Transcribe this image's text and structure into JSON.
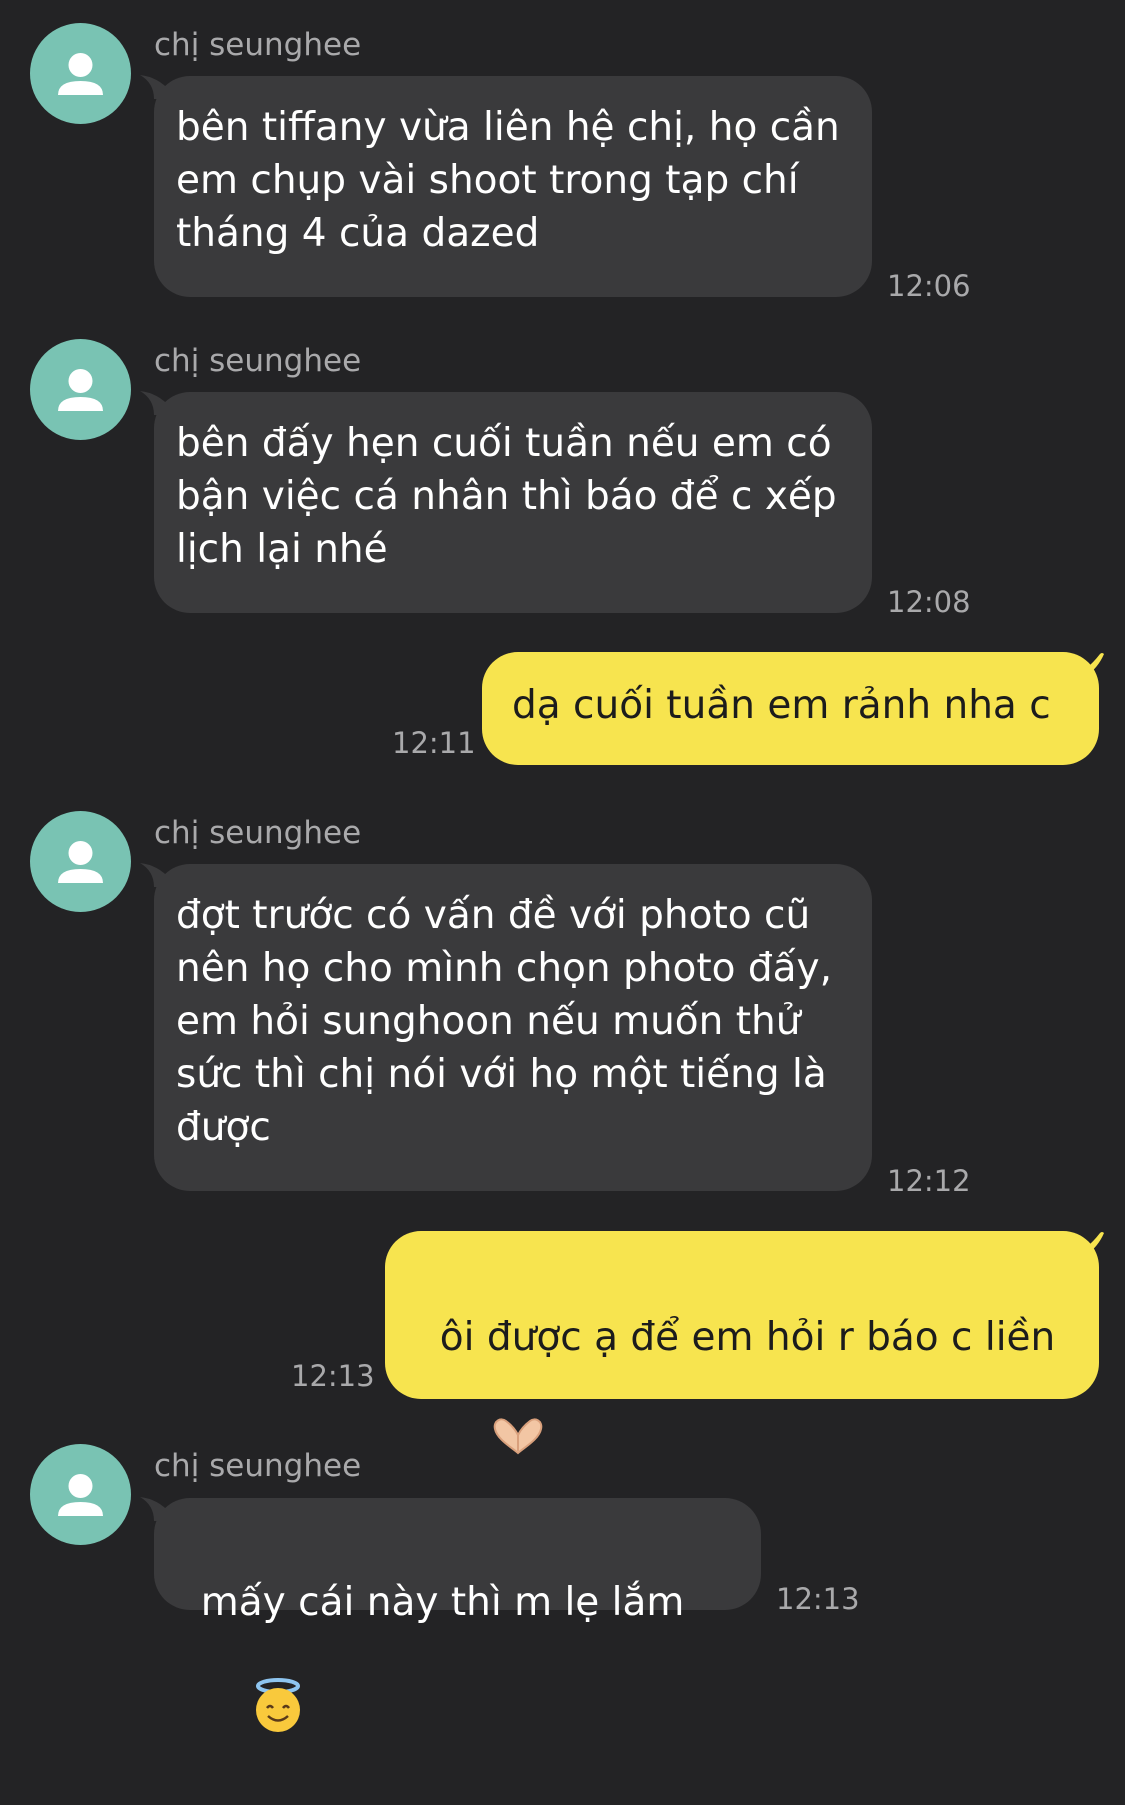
{
  "colors": {
    "background": "#232325",
    "incoming_bubble": "#3a3a3c",
    "outgoing_bubble": "#f7e44f",
    "avatar": "#79c3b3",
    "secondary_text": "#a9a9ab"
  },
  "messages": [
    {
      "direction": "incoming",
      "sender": "chị seunghee",
      "avatar_icon": "person-icon",
      "text": "bên tiffany vừa liên hệ chị, họ cần em chụp vài shoot trong tạp chí tháng 4 của dazed",
      "time": "12:06"
    },
    {
      "direction": "incoming",
      "sender": "chị seunghee",
      "avatar_icon": "person-icon",
      "text": "bên đấy hẹn cuối tuần nếu em có bận việc cá nhân thì báo để c xếp lịch lại nhé",
      "time": "12:08"
    },
    {
      "direction": "outgoing",
      "text": "dạ cuối tuần em rảnh nha c",
      "time": "12:11"
    },
    {
      "direction": "incoming",
      "sender": "chị seunghee",
      "avatar_icon": "person-icon",
      "text": "đợt trước có vấn đề với photo cũ nên họ cho mình chọn photo đấy, em hỏi sunghoon nếu muốn thử sức thì chị nói với họ một tiếng là được",
      "time": "12:12"
    },
    {
      "direction": "outgoing",
      "text": "ôi được ạ để em hỏi r báo c liền",
      "emoji": "heart-hands-emoji",
      "time": "12:13"
    },
    {
      "direction": "incoming",
      "sender": "chị seunghee",
      "avatar_icon": "person-icon",
      "text": "mấy cái này thì m lẹ lắm",
      "emoji": "smiling-face-with-halo-emoji",
      "time": "12:13"
    }
  ]
}
